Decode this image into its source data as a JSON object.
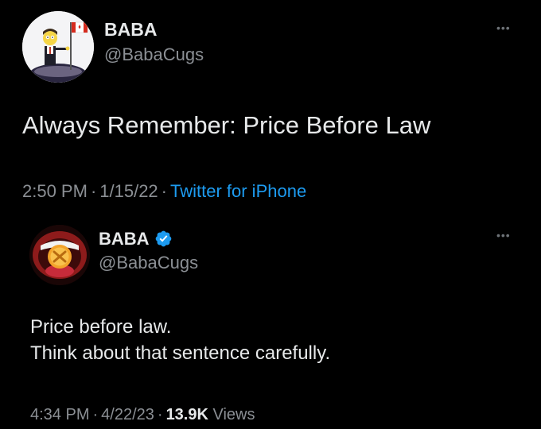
{
  "tweets": [
    {
      "name": "BABA",
      "handle": "@BabaCugs",
      "text_lines": [
        "Always Remember: Price Before Law"
      ],
      "time": "2:50 PM",
      "date": "1/15/22",
      "separator": "·",
      "source": "Twitter for iPhone",
      "more": "•••",
      "avatar_icon": "cartoon-character-flag-avatar"
    },
    {
      "name": "BABA",
      "handle": "@BabaCugs",
      "verified": true,
      "verified_icon": "verified-badge-icon",
      "text_lines": [
        "Price before law.",
        "Think about that sentence carefully."
      ],
      "time": "4:34 PM",
      "date": "4/22/23",
      "separator": "·",
      "views_count": "13.9K",
      "views_label": "Views",
      "more": "•••",
      "avatar_icon": "coin-in-mouth-avatar"
    }
  ],
  "colors": {
    "background": "#000000",
    "primary_text": "#e7e9ea",
    "secondary_text": "#8b8f94",
    "link": "#1d9bf0",
    "verified": "#1d9bf0"
  }
}
